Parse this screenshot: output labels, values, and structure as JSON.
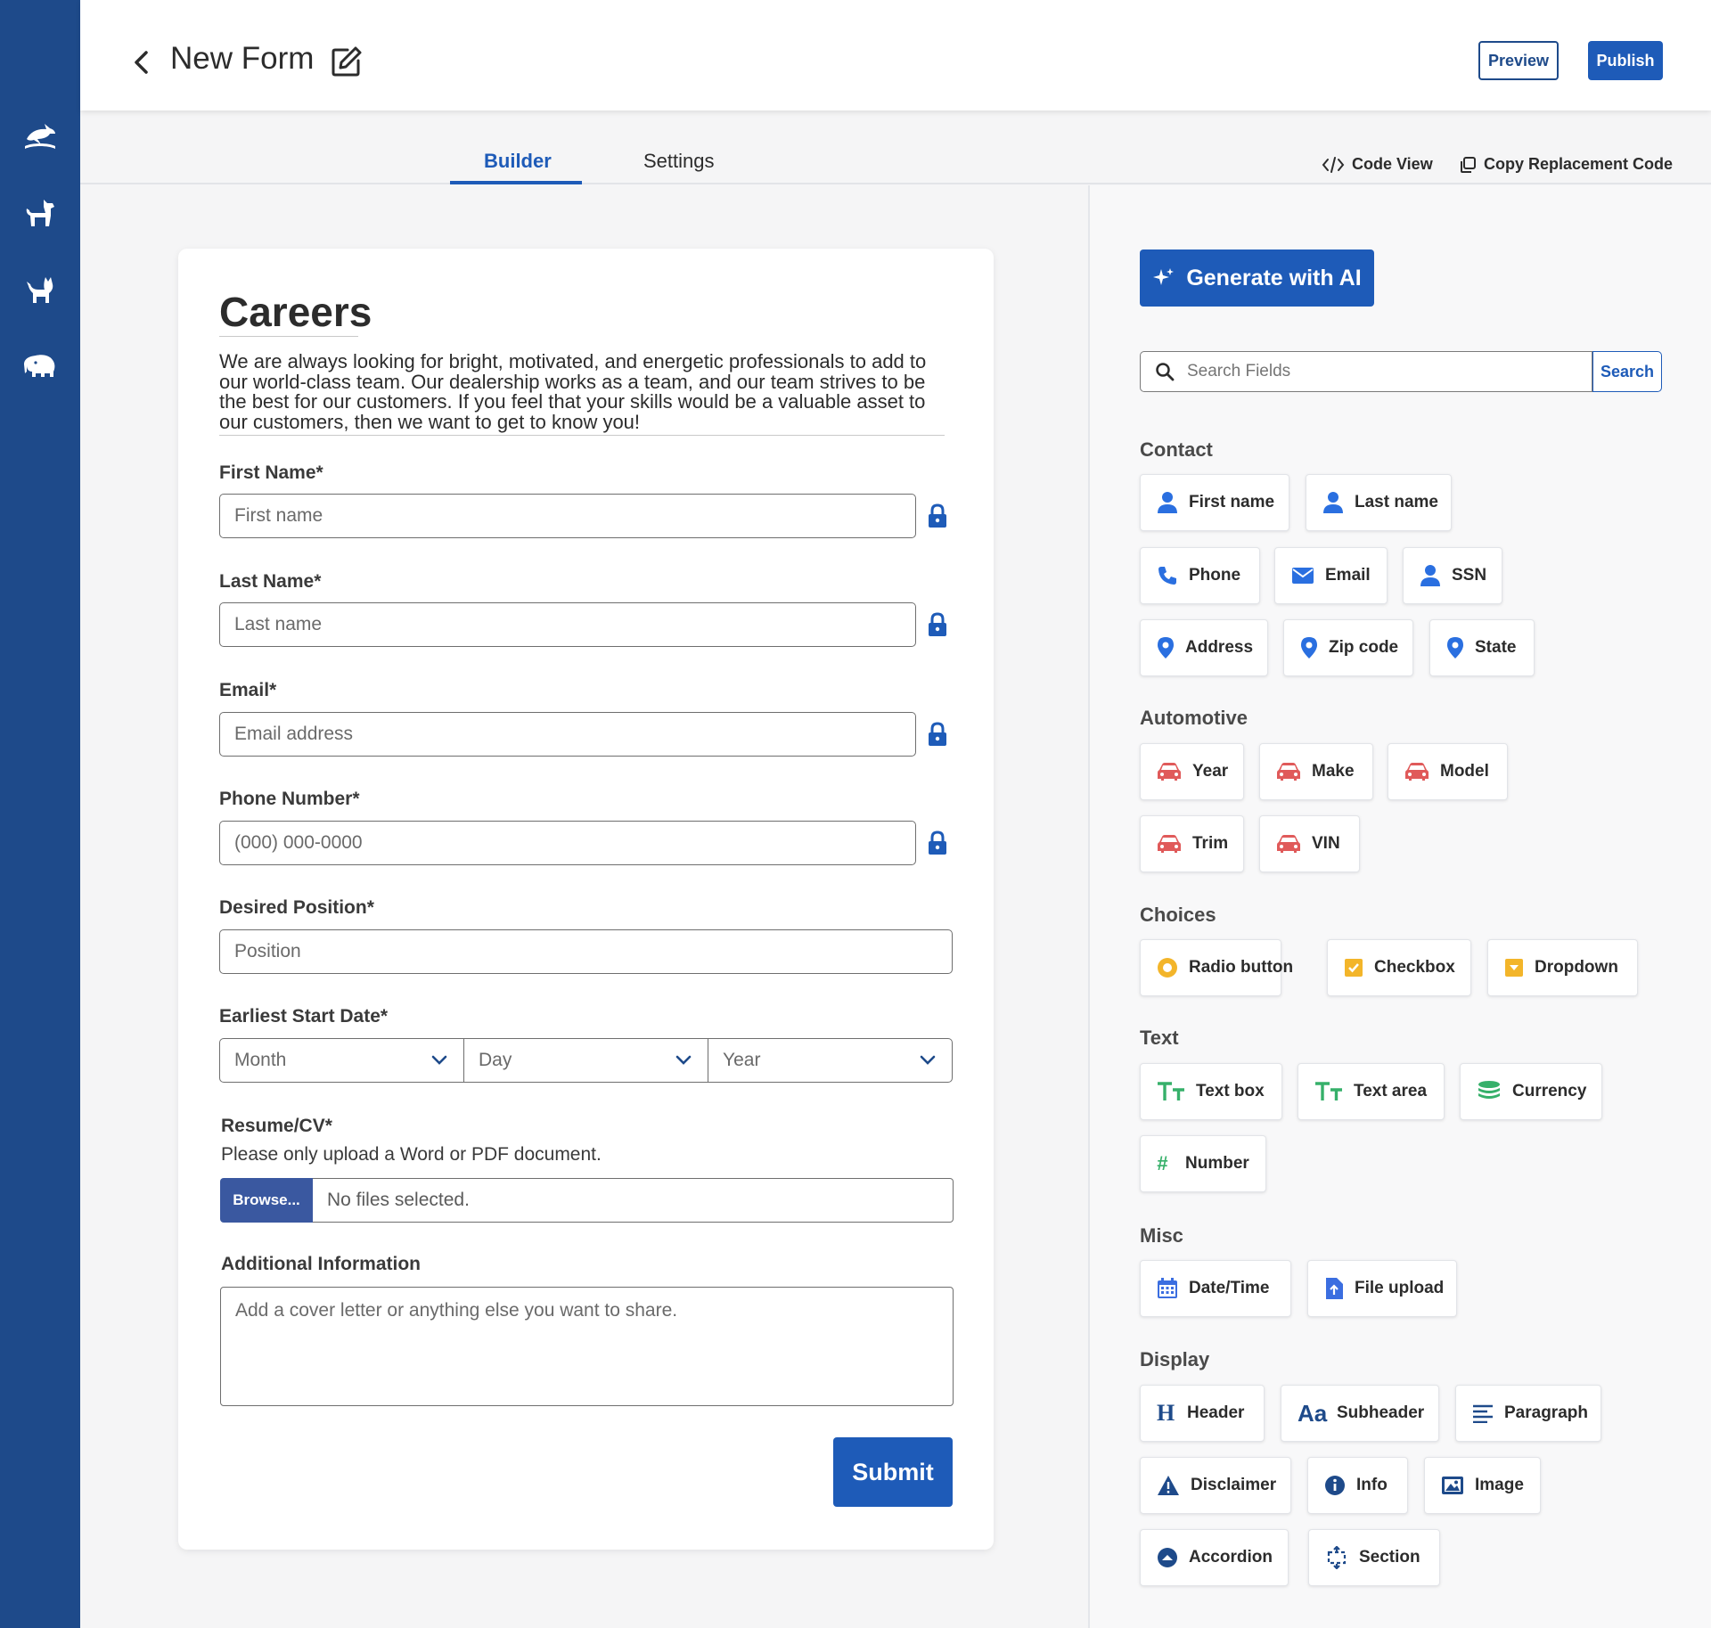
{
  "header": {
    "title": "New Form",
    "preview_label": "Preview",
    "publish_label": "Publish"
  },
  "tabs": {
    "builder": "Builder",
    "settings": "Settings",
    "code_view": "Code View",
    "copy_code": "Copy Replacement Code"
  },
  "form": {
    "title": "Careers",
    "intro": "We are always looking for bright, motivated, and energetic professionals to add to our world-class team. Our dealership works as a team, and our team strives to be the best for our customers. If you feel that your skills would be a valuable asset to our customers, then we want to get to know you!",
    "first_name": {
      "label": "First Name*",
      "placeholder": "First name"
    },
    "last_name": {
      "label": "Last Name*",
      "placeholder": "Last name"
    },
    "email": {
      "label": "Email*",
      "placeholder": "Email address"
    },
    "phone": {
      "label": "Phone Number*",
      "placeholder": "(000) 000-0000"
    },
    "position": {
      "label": "Desired Position*",
      "placeholder": "Position"
    },
    "start_date": {
      "label": "Earliest Start Date*",
      "month": "Month",
      "day": "Day",
      "year": "Year"
    },
    "resume": {
      "label": "Resume/CV*",
      "help": "Please only upload a Word or PDF document.",
      "browse": "Browse...",
      "status": "No files selected."
    },
    "additional": {
      "label": "Additional Information",
      "placeholder": "Add a cover letter or anything else you want to share."
    },
    "submit_label": "Submit"
  },
  "palette": {
    "ai_label": "Generate with AI",
    "search_placeholder": "Search Fields",
    "search_button": "Search",
    "sections": {
      "contact": {
        "title": "Contact",
        "items": [
          "First name",
          "Last name",
          "Phone",
          "Email",
          "SSN",
          "Address",
          "Zip code",
          "State"
        ]
      },
      "automotive": {
        "title": "Automotive",
        "items": [
          "Year",
          "Make",
          "Model",
          "Trim",
          "VIN"
        ]
      },
      "choices": {
        "title": "Choices",
        "items": [
          "Radio button",
          "Checkbox",
          "Dropdown"
        ]
      },
      "text": {
        "title": "Text",
        "items": [
          "Text box",
          "Text area",
          "Currency",
          "Number"
        ]
      },
      "misc": {
        "title": "Misc",
        "items": [
          "Date/Time",
          "File upload"
        ]
      },
      "display": {
        "title": "Display",
        "items": [
          "Header",
          "Subheader",
          "Paragraph",
          "Disclaimer",
          "Info",
          "Image",
          "Accordion",
          "Section"
        ]
      }
    }
  },
  "colors": {
    "rail": "#1e4a8a",
    "accent": "#1e5bb8",
    "contact_icon": "#2a6fe0",
    "automotive_icon": "#e05a5a",
    "choices_icon": "#f3b52a",
    "text_icon": "#36b06a",
    "misc_icon": "#3b6ee0",
    "display_icon": "#1e4a8a"
  }
}
